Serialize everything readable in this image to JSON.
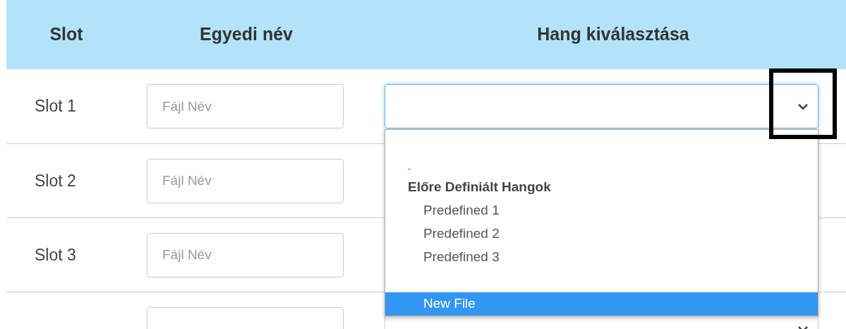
{
  "table": {
    "columns": [
      "Slot",
      "Egyedi név",
      "Hang kiválasztása"
    ],
    "rows": [
      {
        "slot": "Slot 1",
        "name_placeholder": "Fájl Név",
        "sound_open": true
      },
      {
        "slot": "Slot 2",
        "name_placeholder": "Fájl Név"
      },
      {
        "slot": "Slot 3",
        "name_placeholder": "Fájl Név"
      },
      {
        "sound_open": false
      }
    ]
  },
  "dropdown": {
    "items": [
      {
        "kind": "option",
        "label": "-",
        "selected": false
      },
      {
        "kind": "group",
        "label": "Előre Definiált Hangok"
      },
      {
        "kind": "suboption",
        "label": "Predefined 1",
        "selected": false
      },
      {
        "kind": "suboption",
        "label": "Predefined 2",
        "selected": false
      },
      {
        "kind": "suboption",
        "label": "Predefined 3",
        "selected": false
      },
      {
        "kind": "spacer"
      },
      {
        "kind": "suboption",
        "label": "New File",
        "selected": true
      }
    ]
  }
}
